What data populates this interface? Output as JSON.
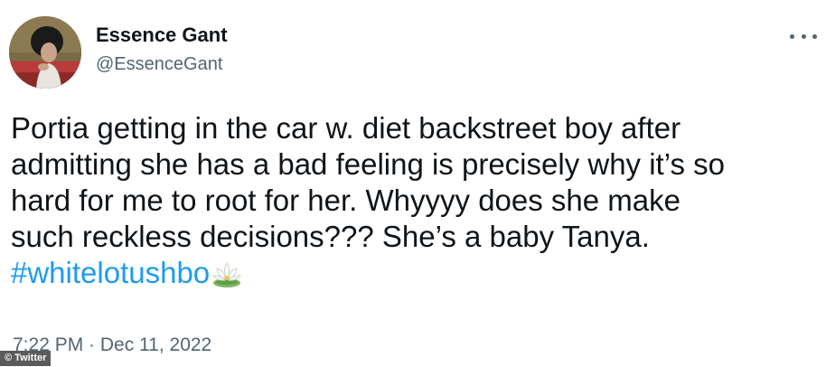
{
  "author": {
    "name": "Essence Gant",
    "handle": "@EssenceGant",
    "avatar_icon": "profile-photo"
  },
  "more_icon": "more-options-icon",
  "tweet": {
    "lines": [
      "Portia getting in the car w. diet backstreet boy after",
      "admitting she has a bad feeling is precisely why it’s so",
      "hard for me to root for her. Whyyyy does she make",
      "such reckless decisions??? She’s a baby Tanya."
    ],
    "hashtag": "#whitelotushbo",
    "emoji_icon": "lotus-emoji"
  },
  "meta": {
    "timestamp": "7:22 PM · Dec 11, 2022"
  },
  "credit": "© Twitter",
  "colors": {
    "text": "#0f1419",
    "secondary": "#536471",
    "link": "#1d9bf0"
  }
}
